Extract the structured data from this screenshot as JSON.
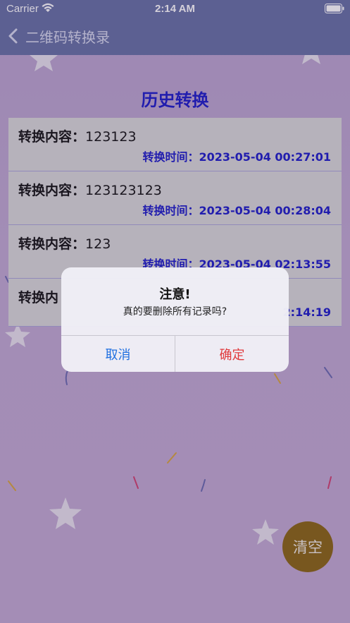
{
  "status_bar": {
    "carrier": "Carrier",
    "time": "2:14 AM"
  },
  "nav": {
    "title": "二维码转换录",
    "back_icon": "chevron-left-icon"
  },
  "page": {
    "title": "历史转换",
    "content_label": "转换内容：",
    "time_label": "转换时间："
  },
  "records": [
    {
      "content": "123123",
      "time": "2023-05-04 00:27:01"
    },
    {
      "content": "123123123",
      "time": "2023-05-04 00:28:04"
    },
    {
      "content": "123",
      "time": "2023-05-04 02:13:55"
    },
    {
      "content": "",
      "time": "2:14:19",
      "partial_label": "转换内"
    }
  ],
  "alert": {
    "title": "注意!",
    "message": "真的要删除所有记录吗?",
    "cancel_label": "取消",
    "confirm_label": "确定"
  },
  "clear_button": {
    "label": "清空"
  },
  "colors": {
    "bar": "#6670a5",
    "accent_blue": "#1a1ac8",
    "cancel": "#1e6fe0",
    "confirm": "#e0393b",
    "clear_bg": "#8a6411"
  }
}
